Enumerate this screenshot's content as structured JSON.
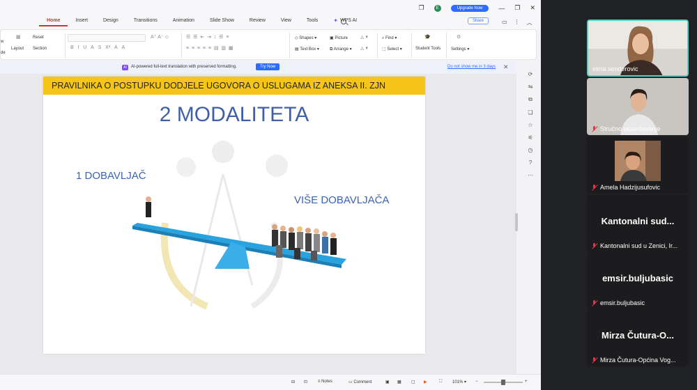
{
  "toolbar": {
    "tabs": [
      "Home",
      "Insert",
      "Design",
      "Transitions",
      "Animation",
      "Slide Show",
      "Review",
      "View",
      "Tools"
    ],
    "wps_ai": "WPS AI",
    "upgrade": "Upgrade Now",
    "share": "Share",
    "avatar_letter": "E"
  },
  "ribbon": {
    "reset": "Reset",
    "layout": "Layout",
    "section": "Section",
    "shapes": "Shapes",
    "picture": "Picture",
    "find": "Find",
    "textbox": "Text Box",
    "arrange": "Arrange",
    "select": "Select",
    "student_tools": "Student Tools",
    "settings": "Settings",
    "new_slide_partial": "w",
    "new_slide_partial2": "de"
  },
  "notice": {
    "message": "AI-powered full-text translation with preserved formatting.",
    "try_now": "Try Now",
    "dont_show": "Do not show me in 3 days"
  },
  "slide": {
    "header": "PRAVILNIKA O POSTUPKU DODJELE UGOVORA O USLUGAMA IZ ANEKSA II. ZJN",
    "title": "2 MODALITETA",
    "label_one": "1 DOBAVLJAČ",
    "label_many": "VIŠE DOBAVLJAČA"
  },
  "status": {
    "notes": "Notes",
    "comment": "Comment",
    "zoom": "101%"
  },
  "participants": [
    {
      "name": "elma.senderovic",
      "video": true,
      "muted": false,
      "active": true
    },
    {
      "name": "Stručno usavršavanje",
      "video": true,
      "muted": true,
      "active": false
    },
    {
      "name": "Amela Hadzijusufovic",
      "video": true,
      "muted": true,
      "active": false
    },
    {
      "name": "Kantonalni sud u Zenici, Ir...",
      "big": "Kantonalni sud...",
      "video": false,
      "muted": true
    },
    {
      "name": "emsir.buljubasic",
      "big": "emsir.buljubasic",
      "video": false,
      "muted": true
    },
    {
      "name": "Mirza Čutura-Općina Vog...",
      "big": "Mirza Čutura-O...",
      "video": false,
      "muted": true
    }
  ],
  "colors": {
    "accent_tab": "#c43d2b",
    "slide_header_bg": "#f5c518",
    "slide_title": "#3f5fa8",
    "seesaw": "#29a3e0",
    "meet_active_border": "#52d1c4"
  }
}
